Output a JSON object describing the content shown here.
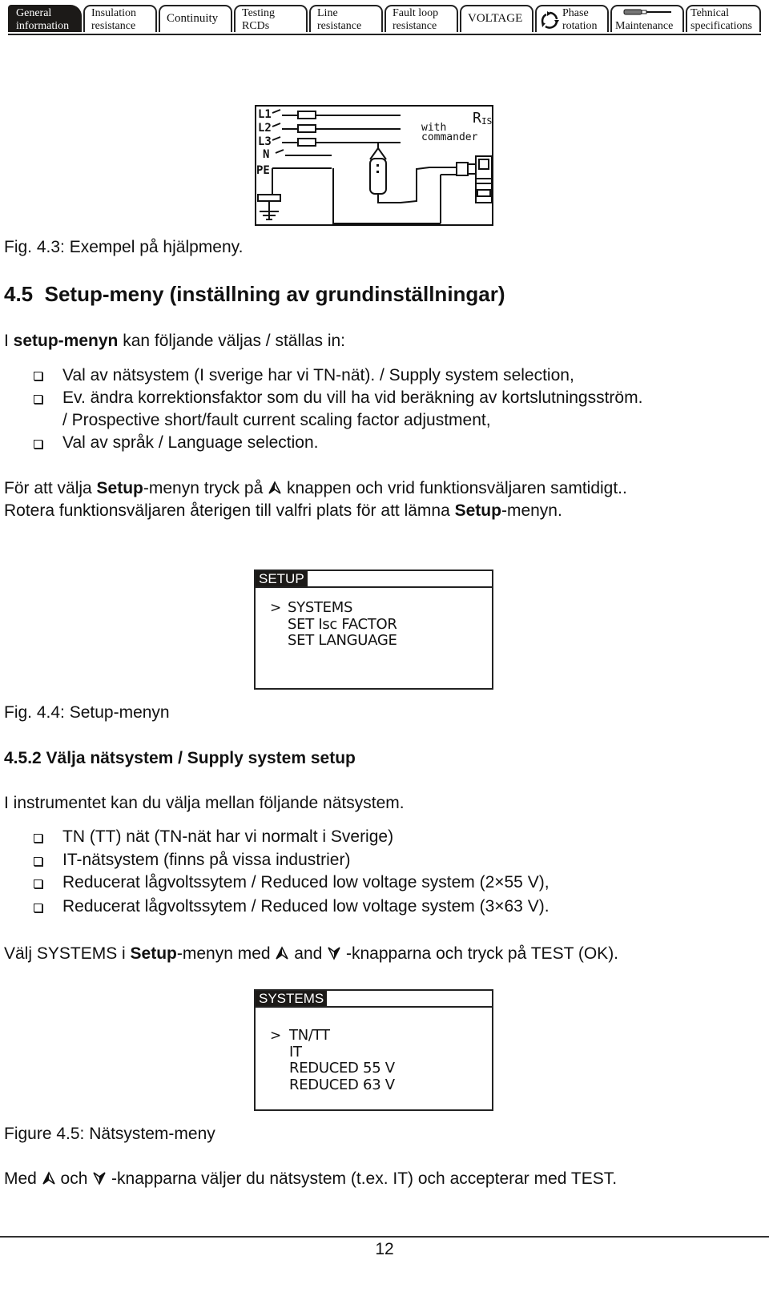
{
  "tabs": [
    {
      "label_line1": "General",
      "label_line2": "information",
      "active": true
    },
    {
      "label_line1": "Insulation",
      "label_line2": "resistance",
      "active": false
    },
    {
      "label_line1": "Continuity",
      "label_line2": "",
      "active": false
    },
    {
      "label_line1": "Testing",
      "label_line2": "RCDs",
      "active": false
    },
    {
      "label_line1": "Line",
      "label_line2": "resistance",
      "active": false
    },
    {
      "label_line1": "Fault loop",
      "label_line2": "resistance",
      "active": false
    },
    {
      "label_line1": "VOLTAGE",
      "label_line2": "",
      "active": false
    },
    {
      "label_line1": "Phase",
      "label_line2": "rotation",
      "icon": "phase-rotation-icon",
      "active": false
    },
    {
      "label_line1": "",
      "label_line2": "Maintenance",
      "icon": "screwdriver-icon",
      "active": false
    },
    {
      "label_line1": "Tehnical",
      "label_line2": "specifications",
      "active": false
    }
  ],
  "figure_43": {
    "lcd_labels": {
      "l1": "L1",
      "l2": "L2",
      "l3": "L3",
      "n": "N",
      "pe": "PE",
      "riso_r": "R",
      "riso_sub": "ISO",
      "with": "with",
      "commander": "commander"
    },
    "caption": "Fig. 4.3: Exempel på hjälpmeny."
  },
  "section_45": {
    "heading_number": "4.5",
    "heading_title": "Setup-meny (inställning av grundinställningar)",
    "intro_prefix": "I ",
    "intro_bold": "setup-menyn",
    "intro_suffix": " kan följande väljas / ställas in:",
    "bullets": [
      "Val av nätsystem (I sverige har vi TN-nät). / Supply system selection,",
      "Ev. ändra korrektionsfaktor som du vill ha vid beräkning av kortslutningsström.",
      "Val av språk / Language selection."
    ],
    "bullet2_continuation": "/ Prospective short/fault current scaling factor adjustment,",
    "para1_a": "För att välja ",
    "para1_bold": "Setup",
    "para1_b": "-menyn tryck på ",
    "para1_c": " knappen och vrid funktionsväljaren samtidigt..",
    "para2_a": "Rotera funktionsväljaren återigen till valfri plats för att lämna ",
    "para2_bold": "Setup",
    "para2_b": "-menyn."
  },
  "setup_menu": {
    "title": "SETUP",
    "cursor": ">",
    "items": [
      "SYSTEMS",
      "SET Isc FACTOR",
      "SET LANGUAGE"
    ],
    "selected_index": 0,
    "caption": "Fig. 4.4: Setup-menyn"
  },
  "section_452": {
    "heading": "4.5.2 Välja nätsystem / Supply system setup",
    "intro": "I instrumentet kan du välja mellan följande nätsystem.",
    "bullets": [
      "TN (TT) nät (TN-nät har vi normalt i Sverige)",
      "IT-nätsystem (finns på vissa industrier)",
      "Reducerat lågvoltssytem  / Reduced low voltage system (2×55 V),",
      "Reducerat lågvoltssytem  / Reduced low voltage system (3×63 V)."
    ],
    "instruction_a": "Välj SYSTEMS i ",
    "instruction_bold": "Setup",
    "instruction_b": "-menyn med ",
    "instruction_c": " and ",
    "instruction_d": " -knapparna och tryck på TEST (OK)."
  },
  "systems_menu": {
    "title": "SYSTEMS",
    "cursor": ">",
    "items": [
      "TN/TT",
      "IT",
      "REDUCED 55 V",
      "REDUCED 63 V"
    ],
    "selected_index": 0,
    "caption": "Figure 4.5: Nätsystem-meny"
  },
  "final_para": {
    "a": "Med ",
    "b": " och ",
    "c": " -knapparna väljer du nätsystem (t.ex. IT) och accepterar med TEST."
  },
  "page_number": "12"
}
